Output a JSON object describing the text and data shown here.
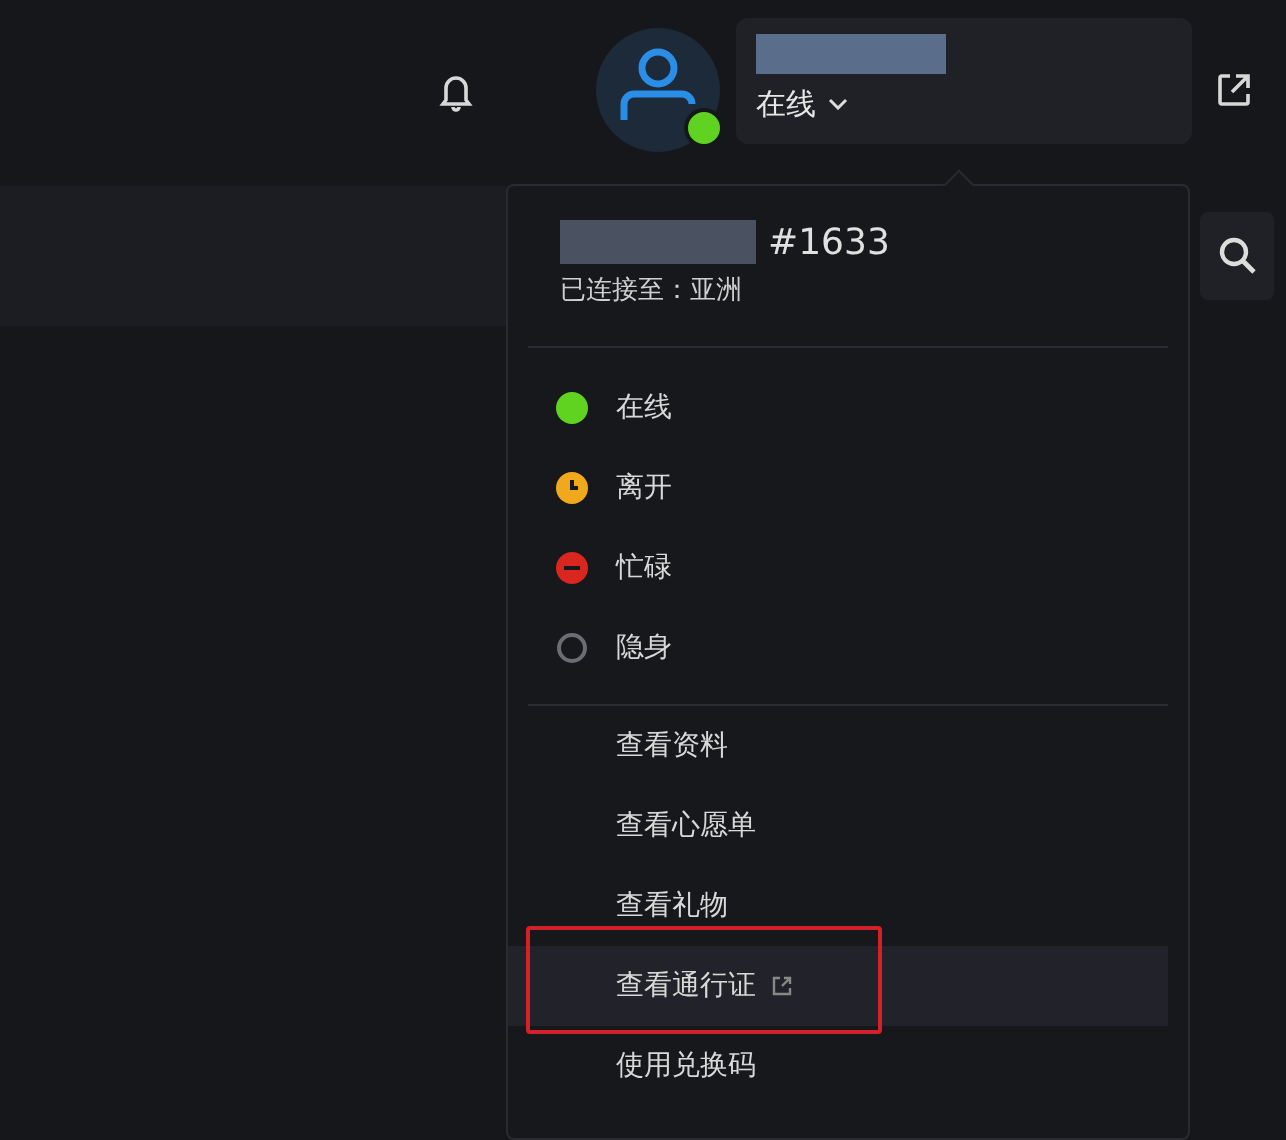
{
  "header": {
    "status_label": "在线"
  },
  "menu": {
    "tag": "#1633",
    "connection": "已连接至：亚洲",
    "statuses": [
      {
        "kind": "online",
        "label": "在线",
        "color": "#5fd31f"
      },
      {
        "kind": "away",
        "label": "离开",
        "color": "#f0a81c"
      },
      {
        "kind": "busy",
        "label": "忙碌",
        "color": "#d9261e"
      },
      {
        "kind": "invisible",
        "label": "隐身",
        "color": "#6b6d73"
      }
    ],
    "items": [
      {
        "label": "查看资料",
        "highlighted": false,
        "external": false,
        "annotated": false
      },
      {
        "label": "查看心愿单",
        "highlighted": false,
        "external": false,
        "annotated": false
      },
      {
        "label": "查看礼物",
        "highlighted": false,
        "external": false,
        "annotated": false
      },
      {
        "label": "查看通行证",
        "highlighted": true,
        "external": true,
        "annotated": true
      },
      {
        "label": "使用兑换码",
        "highlighted": false,
        "external": false,
        "annotated": false
      }
    ]
  }
}
